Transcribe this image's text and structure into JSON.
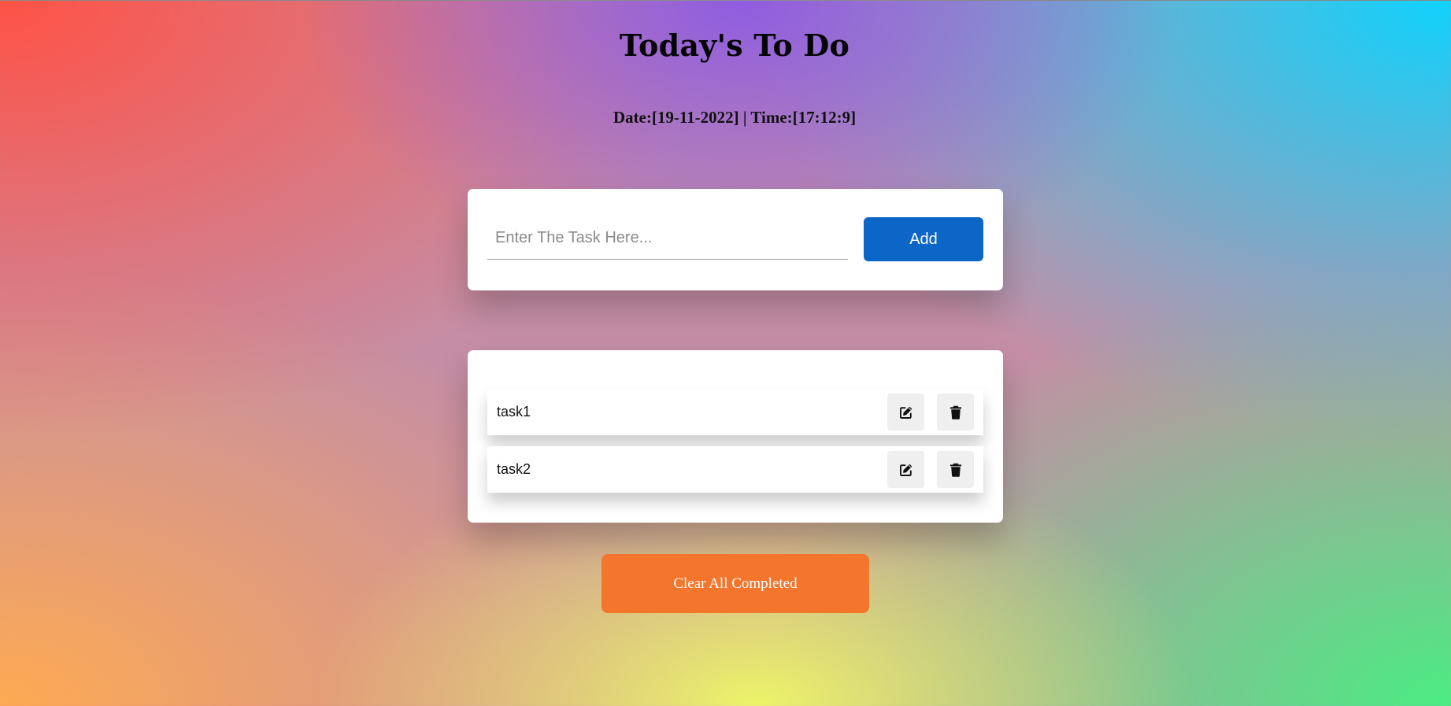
{
  "header": {
    "title": "Today's To Do",
    "datetime": "Date:[19-11-2022] | Time:[17:12:9]"
  },
  "task_input": {
    "placeholder": "Enter The Task Here...",
    "value": "",
    "add_label": "Add"
  },
  "tasks": [
    {
      "label": "task1",
      "edit_icon": "edit-icon",
      "delete_icon": "trash-icon"
    },
    {
      "label": "task2",
      "edit_icon": "edit-icon",
      "delete_icon": "trash-icon"
    }
  ],
  "footer": {
    "clear_label": "Clear All Completed"
  },
  "colors": {
    "add_button": "#0b66c8",
    "clear_button": "#f4752c",
    "icon_button_bg": "#efefef"
  }
}
